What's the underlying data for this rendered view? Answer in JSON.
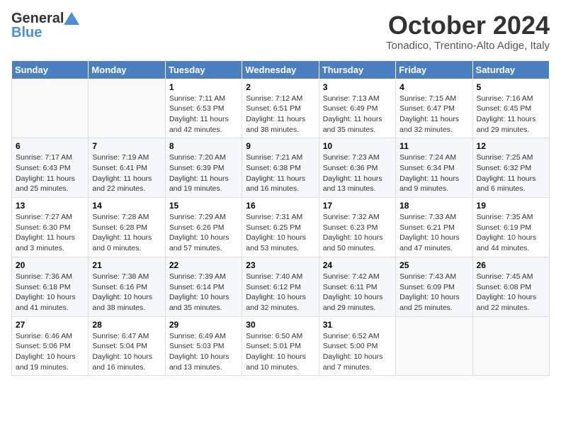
{
  "header": {
    "logo_general": "General",
    "logo_blue": "Blue",
    "title": "October 2024",
    "subtitle": "Tonadico, Trentino-Alto Adige, Italy"
  },
  "days_of_week": [
    "Sunday",
    "Monday",
    "Tuesday",
    "Wednesday",
    "Thursday",
    "Friday",
    "Saturday"
  ],
  "weeks": [
    [
      {
        "num": "",
        "info": ""
      },
      {
        "num": "",
        "info": ""
      },
      {
        "num": "1",
        "info": "Sunrise: 7:11 AM\nSunset: 6:53 PM\nDaylight: 11 hours and 42 minutes."
      },
      {
        "num": "2",
        "info": "Sunrise: 7:12 AM\nSunset: 6:51 PM\nDaylight: 11 hours and 38 minutes."
      },
      {
        "num": "3",
        "info": "Sunrise: 7:13 AM\nSunset: 6:49 PM\nDaylight: 11 hours and 35 minutes."
      },
      {
        "num": "4",
        "info": "Sunrise: 7:15 AM\nSunset: 6:47 PM\nDaylight: 11 hours and 32 minutes."
      },
      {
        "num": "5",
        "info": "Sunrise: 7:16 AM\nSunset: 6:45 PM\nDaylight: 11 hours and 29 minutes."
      }
    ],
    [
      {
        "num": "6",
        "info": "Sunrise: 7:17 AM\nSunset: 6:43 PM\nDaylight: 11 hours and 25 minutes."
      },
      {
        "num": "7",
        "info": "Sunrise: 7:19 AM\nSunset: 6:41 PM\nDaylight: 11 hours and 22 minutes."
      },
      {
        "num": "8",
        "info": "Sunrise: 7:20 AM\nSunset: 6:39 PM\nDaylight: 11 hours and 19 minutes."
      },
      {
        "num": "9",
        "info": "Sunrise: 7:21 AM\nSunset: 6:38 PM\nDaylight: 11 hours and 16 minutes."
      },
      {
        "num": "10",
        "info": "Sunrise: 7:23 AM\nSunset: 6:36 PM\nDaylight: 11 hours and 13 minutes."
      },
      {
        "num": "11",
        "info": "Sunrise: 7:24 AM\nSunset: 6:34 PM\nDaylight: 11 hours and 9 minutes."
      },
      {
        "num": "12",
        "info": "Sunrise: 7:25 AM\nSunset: 6:32 PM\nDaylight: 11 hours and 6 minutes."
      }
    ],
    [
      {
        "num": "13",
        "info": "Sunrise: 7:27 AM\nSunset: 6:30 PM\nDaylight: 11 hours and 3 minutes."
      },
      {
        "num": "14",
        "info": "Sunrise: 7:28 AM\nSunset: 6:28 PM\nDaylight: 11 hours and 0 minutes."
      },
      {
        "num": "15",
        "info": "Sunrise: 7:29 AM\nSunset: 6:26 PM\nDaylight: 10 hours and 57 minutes."
      },
      {
        "num": "16",
        "info": "Sunrise: 7:31 AM\nSunset: 6:25 PM\nDaylight: 10 hours and 53 minutes."
      },
      {
        "num": "17",
        "info": "Sunrise: 7:32 AM\nSunset: 6:23 PM\nDaylight: 10 hours and 50 minutes."
      },
      {
        "num": "18",
        "info": "Sunrise: 7:33 AM\nSunset: 6:21 PM\nDaylight: 10 hours and 47 minutes."
      },
      {
        "num": "19",
        "info": "Sunrise: 7:35 AM\nSunset: 6:19 PM\nDaylight: 10 hours and 44 minutes."
      }
    ],
    [
      {
        "num": "20",
        "info": "Sunrise: 7:36 AM\nSunset: 6:18 PM\nDaylight: 10 hours and 41 minutes."
      },
      {
        "num": "21",
        "info": "Sunrise: 7:38 AM\nSunset: 6:16 PM\nDaylight: 10 hours and 38 minutes."
      },
      {
        "num": "22",
        "info": "Sunrise: 7:39 AM\nSunset: 6:14 PM\nDaylight: 10 hours and 35 minutes."
      },
      {
        "num": "23",
        "info": "Sunrise: 7:40 AM\nSunset: 6:12 PM\nDaylight: 10 hours and 32 minutes."
      },
      {
        "num": "24",
        "info": "Sunrise: 7:42 AM\nSunset: 6:11 PM\nDaylight: 10 hours and 29 minutes."
      },
      {
        "num": "25",
        "info": "Sunrise: 7:43 AM\nSunset: 6:09 PM\nDaylight: 10 hours and 25 minutes."
      },
      {
        "num": "26",
        "info": "Sunrise: 7:45 AM\nSunset: 6:08 PM\nDaylight: 10 hours and 22 minutes."
      }
    ],
    [
      {
        "num": "27",
        "info": "Sunrise: 6:46 AM\nSunset: 5:06 PM\nDaylight: 10 hours and 19 minutes."
      },
      {
        "num": "28",
        "info": "Sunrise: 6:47 AM\nSunset: 5:04 PM\nDaylight: 10 hours and 16 minutes."
      },
      {
        "num": "29",
        "info": "Sunrise: 6:49 AM\nSunset: 5:03 PM\nDaylight: 10 hours and 13 minutes."
      },
      {
        "num": "30",
        "info": "Sunrise: 6:50 AM\nSunset: 5:01 PM\nDaylight: 10 hours and 10 minutes."
      },
      {
        "num": "31",
        "info": "Sunrise: 6:52 AM\nSunset: 5:00 PM\nDaylight: 10 hours and 7 minutes."
      },
      {
        "num": "",
        "info": ""
      },
      {
        "num": "",
        "info": ""
      }
    ]
  ]
}
